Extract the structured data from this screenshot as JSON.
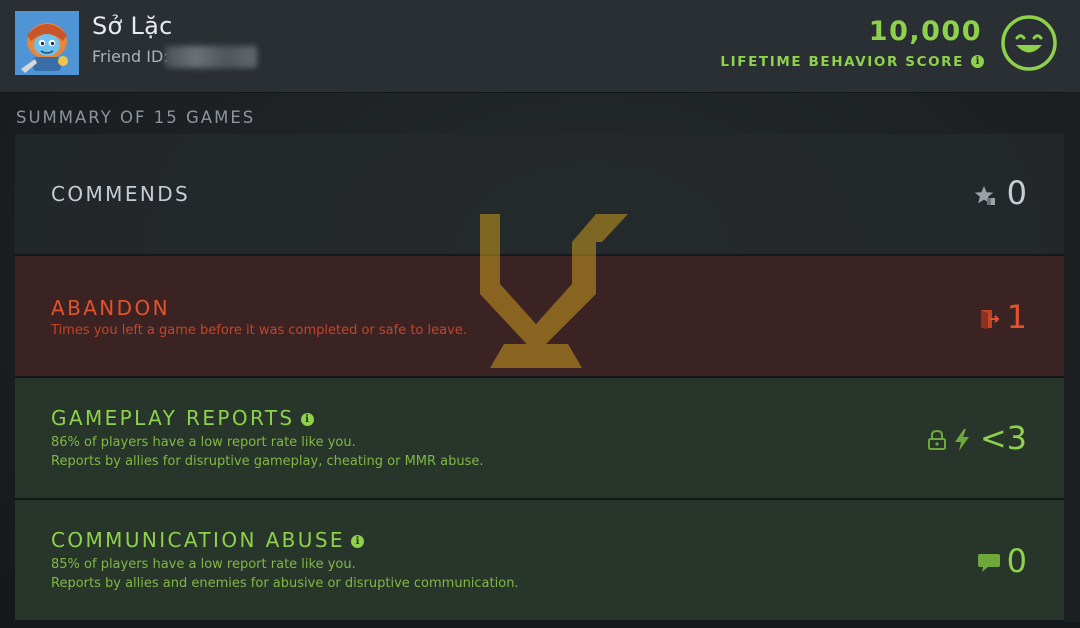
{
  "header": {
    "player_name": "Sở Lặc",
    "friend_id_label": "Friend ID:",
    "score_value": "10,000",
    "score_label": "LIFETIME BEHAVIOR SCORE",
    "score_info_icon": "info-icon",
    "mood_icon": "smiley-face-icon",
    "avatar_icon": "hero-portrait-icon"
  },
  "summary": {
    "title": "SUMMARY OF 15 GAMES"
  },
  "rows": {
    "commends": {
      "title": "COMMENDS",
      "value": "0",
      "icon": "star-thumbs-up-icon"
    },
    "abandon": {
      "title": "ABANDON",
      "desc": "Times you left a game before it was completed or safe to leave.",
      "value": "1",
      "icon": "exit-door-icon"
    },
    "gameplay": {
      "title": "GAMEPLAY REPORTS",
      "desc1": "86% of players have a low report rate like you.",
      "desc2": "Reports by allies for disruptive gameplay, cheating or MMR abuse.",
      "value": "<3",
      "icons": [
        "lock-icon",
        "lightning-bolt-icon"
      ]
    },
    "communication": {
      "title": "COMMUNICATION ABUSE",
      "desc1": "85% of players have a low report rate like you.",
      "desc2": "Reports by allies and enemies for abusive or disruptive communication.",
      "value": "0",
      "icon": "chat-bubble-icon"
    }
  },
  "colors": {
    "green": "#8ed14b",
    "orange": "#e3532b",
    "gray_text": "#8d959b",
    "watermark": "#c79a1e"
  }
}
